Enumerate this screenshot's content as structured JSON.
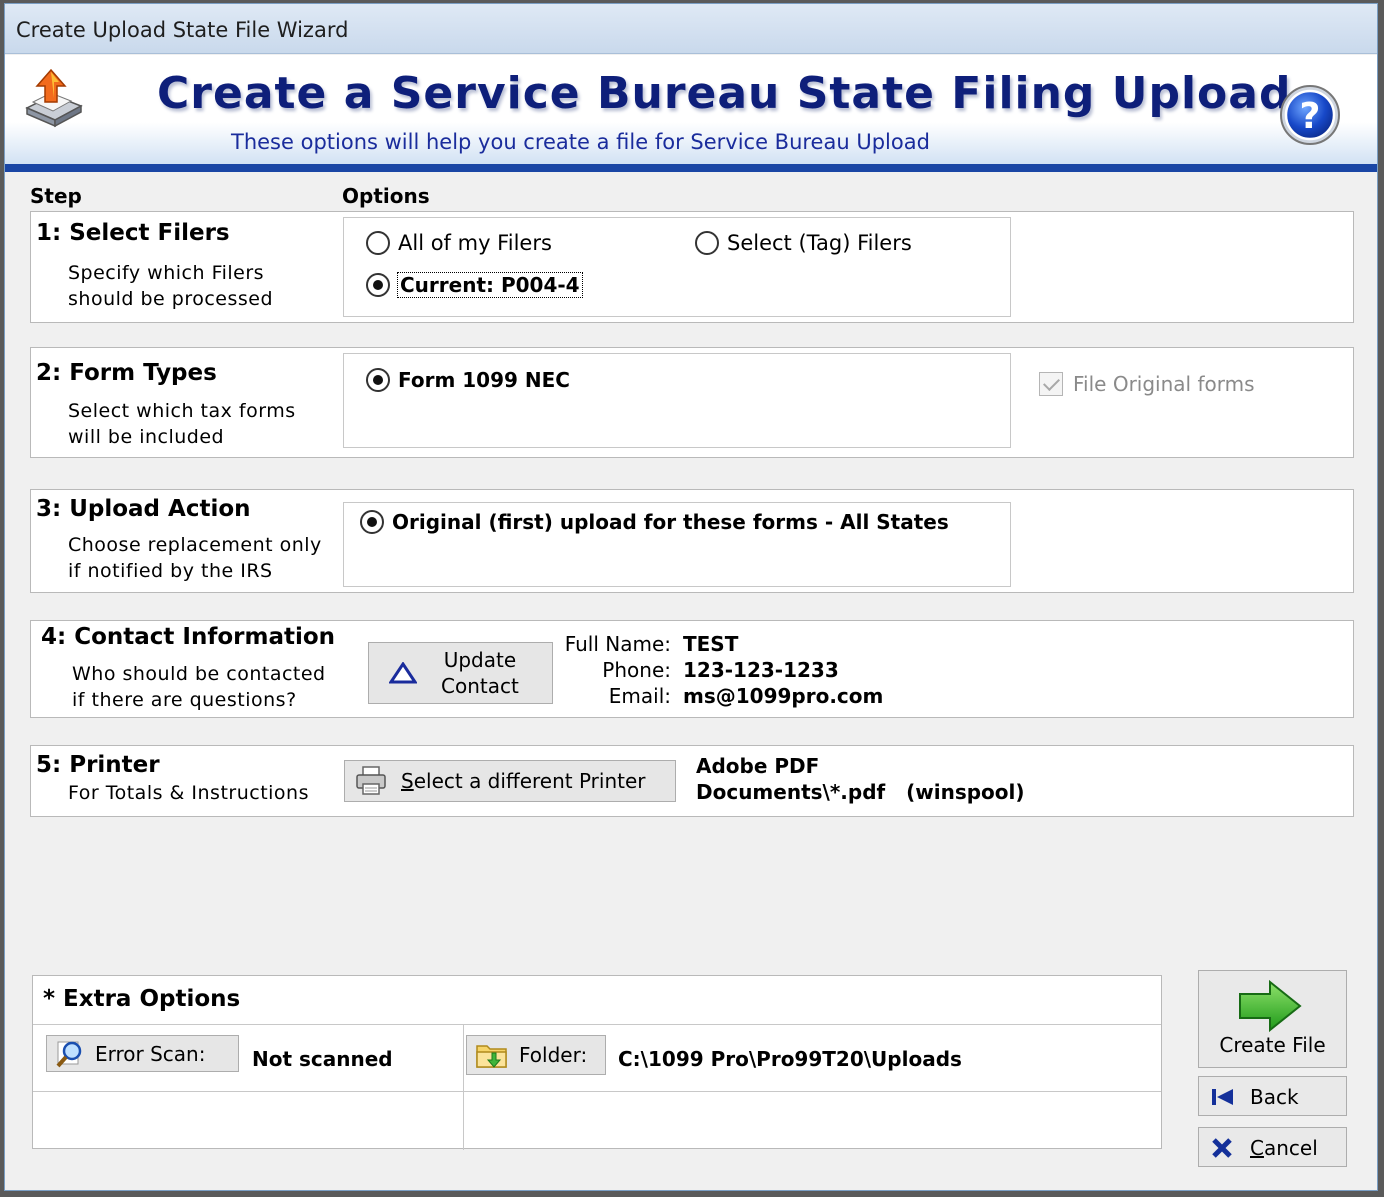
{
  "window": {
    "title": "Create Upload State File Wizard"
  },
  "banner": {
    "title": "Create a Service Bureau State Filing Upload",
    "subtitle": "These options will help you create a file for Service Bureau Upload"
  },
  "columns": {
    "step": "Step",
    "options": "Options"
  },
  "steps": {
    "filers": {
      "title": "1: Select Filers",
      "desc1": "Specify which Filers",
      "desc2": "should be processed",
      "options": [
        {
          "label": "All of my Filers",
          "selected": false
        },
        {
          "label": "Select (Tag) Filers",
          "selected": false
        },
        {
          "label": "Current: P004-4",
          "selected": true
        }
      ]
    },
    "forms": {
      "title": "2: Form Types",
      "desc1": "Select which tax forms",
      "desc2": "will be included",
      "option": "Form 1099 NEC",
      "file_original_label": "File Original forms",
      "file_original_checked": true
    },
    "upload": {
      "title": "3: Upload Action",
      "desc1": "Choose replacement only",
      "desc2": "if notified by the IRS",
      "option": "Original (first) upload for these forms - All States"
    },
    "contact": {
      "title": "4: Contact Information",
      "desc1": "Who should be contacted",
      "desc2": "if there are questions?",
      "button_line1": "Update",
      "button_line2": "Contact",
      "name_label": "Full Name:",
      "name_value": "TEST",
      "phone_label": "Phone:",
      "phone_value": "123-123-1233",
      "email_label": "Email:",
      "email_value": "ms@1099pro.com"
    },
    "printer": {
      "title": "5: Printer",
      "desc1": "For Totals & Instructions",
      "button_rest": "elect a different Printer",
      "button_mnemonic": "S",
      "printer_name": "Adobe PDF",
      "printer_port": "Documents\\*.pdf   (winspool)"
    }
  },
  "extra": {
    "title": "* Extra Options",
    "error_scan_label": "Error Scan:",
    "error_scan_value": "Not scanned",
    "folder_label": "Folder:",
    "folder_value": "C:\\1099 Pro\\Pro99T20\\Uploads"
  },
  "actions": {
    "create_file": "Create File",
    "back": "Back",
    "cancel_mnemonic": "C",
    "cancel_rest": "ancel"
  },
  "icons": {
    "logo": "upload-tray-icon",
    "help": "help-icon",
    "contact": "triangle-icon",
    "printer": "printer-icon",
    "error_scan": "magnifier-icon",
    "folder": "folder-icon",
    "create": "green-arrow-icon",
    "back": "back-icon",
    "cancel": "x-icon"
  },
  "colors": {
    "title_blue": "#0e1f7a",
    "stripe": "#1a46a5",
    "window_bg": "#f0f0f0"
  }
}
